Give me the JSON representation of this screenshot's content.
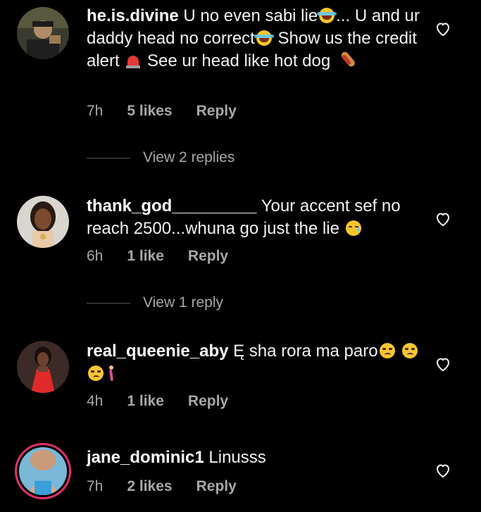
{
  "comments": [
    {
      "username": "he.is.divine",
      "text_segments": [
        "U no even sabi lie",
        "... U and ur daddy head no correct",
        " Show us the credit alert",
        " See ur head like hot dog"
      ],
      "emojis": [
        "laugh-cry-emoji",
        "laugh-cry-emoji",
        "siren-emoji",
        "hotdog-emoji"
      ],
      "time": "7h",
      "likes": "5 likes",
      "reply": "Reply",
      "view_replies": "View 2 replies"
    },
    {
      "username": "thank_god_________",
      "text_segments": [
        "Your accent sef no reach 2500...whuna go just the lie"
      ],
      "emojis": [
        "sleepy-emoji"
      ],
      "time": "6h",
      "likes": "1 like",
      "reply": "Reply",
      "view_replies": "View 1 reply"
    },
    {
      "username": "real_queenie_aby",
      "text_segments": [
        "Ę sha rora ma paro"
      ],
      "emojis": [
        "unamused-emoji",
        "unamused-emoji",
        "unamused-emoji",
        "woman-walking-emoji"
      ],
      "time": "4h",
      "likes": "1 like",
      "reply": "Reply"
    },
    {
      "username": "jane_dominic1",
      "text_segments": [
        "Linusss"
      ],
      "emojis": [],
      "time": "7h",
      "likes": "2 likes",
      "reply": "Reply"
    }
  ],
  "colors": {
    "background": "#000000",
    "text": "#f2f2f2",
    "meta": "#a8a8a8",
    "story_ring": "#e1306c"
  },
  "icons": {
    "like": "heart-outline-icon"
  }
}
